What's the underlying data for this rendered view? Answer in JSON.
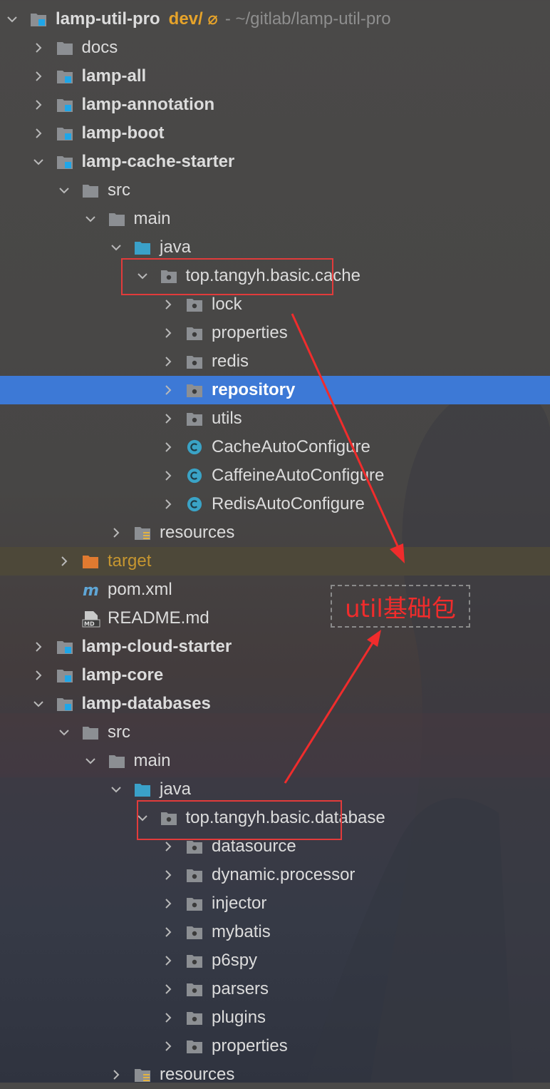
{
  "project": {
    "name": "lamp-util-pro",
    "branch": "dev/",
    "branch_icon": "⌀",
    "path": "- ~/gitlab/lamp-util-pro"
  },
  "tree": [
    {
      "label": "docs",
      "level": 1,
      "chevron": "right",
      "icon": "folder",
      "bold": false
    },
    {
      "label": "lamp-all",
      "level": 1,
      "chevron": "right",
      "icon": "module-folder",
      "bold": true
    },
    {
      "label": "lamp-annotation",
      "level": 1,
      "chevron": "right",
      "icon": "module-folder",
      "bold": true
    },
    {
      "label": "lamp-boot",
      "level": 1,
      "chevron": "right",
      "icon": "module-folder",
      "bold": true
    },
    {
      "label": "lamp-cache-starter",
      "level": 1,
      "chevron": "down",
      "icon": "module-folder",
      "bold": true
    },
    {
      "label": "src",
      "level": 2,
      "chevron": "down",
      "icon": "folder",
      "bold": false
    },
    {
      "label": "main",
      "level": 3,
      "chevron": "down",
      "icon": "folder",
      "bold": false
    },
    {
      "label": "java",
      "level": 4,
      "chevron": "down",
      "icon": "source-folder",
      "bold": false
    },
    {
      "label": "top.tangyh.basic.cache",
      "level": 5,
      "chevron": "down",
      "icon": "package",
      "bold": false
    },
    {
      "label": "lock",
      "level": 6,
      "chevron": "right",
      "icon": "package",
      "bold": false
    },
    {
      "label": "properties",
      "level": 6,
      "chevron": "right",
      "icon": "package",
      "bold": false
    },
    {
      "label": "redis",
      "level": 6,
      "chevron": "right",
      "icon": "package",
      "bold": false
    },
    {
      "label": "repository",
      "level": 6,
      "chevron": "right",
      "icon": "package",
      "bold": false,
      "selected": true
    },
    {
      "label": "utils",
      "level": 6,
      "chevron": "right",
      "icon": "package",
      "bold": false
    },
    {
      "label": "CacheAutoConfigure",
      "level": 6,
      "chevron": "right",
      "icon": "class",
      "bold": false
    },
    {
      "label": "CaffeineAutoConfigure",
      "level": 6,
      "chevron": "right",
      "icon": "class",
      "bold": false
    },
    {
      "label": "RedisAutoConfigure",
      "level": 6,
      "chevron": "right",
      "icon": "class",
      "bold": false
    },
    {
      "label": "resources",
      "level": 4,
      "chevron": "right",
      "icon": "resources-folder",
      "bold": false
    },
    {
      "label": "target",
      "level": 2,
      "chevron": "right",
      "icon": "excluded-folder",
      "bold": false,
      "excluded": true
    },
    {
      "label": "pom.xml",
      "level": 2,
      "chevron": "none",
      "icon": "maven",
      "bold": false
    },
    {
      "label": "README.md",
      "level": 2,
      "chevron": "none",
      "icon": "markdown",
      "bold": false
    },
    {
      "label": "lamp-cloud-starter",
      "level": 1,
      "chevron": "right",
      "icon": "module-folder",
      "bold": true
    },
    {
      "label": "lamp-core",
      "level": 1,
      "chevron": "right",
      "icon": "module-folder",
      "bold": true
    },
    {
      "label": "lamp-databases",
      "level": 1,
      "chevron": "down",
      "icon": "module-folder",
      "bold": true
    },
    {
      "label": "src",
      "level": 2,
      "chevron": "down",
      "icon": "folder",
      "bold": false
    },
    {
      "label": "main",
      "level": 3,
      "chevron": "down",
      "icon": "folder",
      "bold": false
    },
    {
      "label": "java",
      "level": 4,
      "chevron": "down",
      "icon": "source-folder",
      "bold": false
    },
    {
      "label": "top.tangyh.basic.database",
      "level": 5,
      "chevron": "down",
      "icon": "package",
      "bold": false
    },
    {
      "label": "datasource",
      "level": 6,
      "chevron": "right",
      "icon": "package",
      "bold": false
    },
    {
      "label": "dynamic.processor",
      "level": 6,
      "chevron": "right",
      "icon": "package",
      "bold": false
    },
    {
      "label": "injector",
      "level": 6,
      "chevron": "right",
      "icon": "package",
      "bold": false
    },
    {
      "label": "mybatis",
      "level": 6,
      "chevron": "right",
      "icon": "package",
      "bold": false
    },
    {
      "label": "p6spy",
      "level": 6,
      "chevron": "right",
      "icon": "package",
      "bold": false
    },
    {
      "label": "parsers",
      "level": 6,
      "chevron": "right",
      "icon": "package",
      "bold": false
    },
    {
      "label": "plugins",
      "level": 6,
      "chevron": "right",
      "icon": "package",
      "bold": false
    },
    {
      "label": "properties",
      "level": 6,
      "chevron": "right",
      "icon": "package",
      "bold": false
    },
    {
      "label": "resources",
      "level": 4,
      "chevron": "right",
      "icon": "resources-folder",
      "bold": false
    }
  ],
  "annotation": {
    "label": "util基础包",
    "color": "#f02c2c"
  },
  "colors": {
    "selection": "#3d79d6",
    "module_accent": "#1fa6e8",
    "folder_gray": "#8c8f93",
    "source_folder": "#3aa1c9",
    "class_icon": "#3aa3c6",
    "excluded_folder": "#e07a30",
    "branch": "#e6a32a"
  }
}
